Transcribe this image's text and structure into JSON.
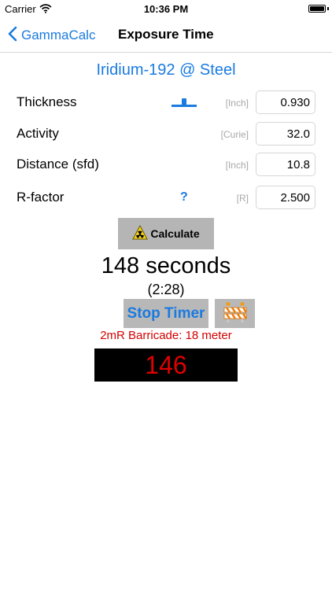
{
  "status_bar": {
    "carrier": "Carrier",
    "time": "10:36 PM"
  },
  "nav": {
    "back_label": "GammaCalc",
    "title": "Exposure Time"
  },
  "header": {
    "title": "Iridium-192 @ Steel"
  },
  "rows": [
    {
      "label": "Thickness",
      "unit": "[Inch]",
      "value": "0.930"
    },
    {
      "label": "Activity",
      "unit": "[Curie]",
      "value": "32.0"
    },
    {
      "label": "Distance (sfd)",
      "unit": "[Inch]",
      "value": "10.8"
    },
    {
      "label": "R-factor",
      "unit": "[R]",
      "value": "2.500"
    }
  ],
  "help_icon": "?",
  "calculate_label": "Calculate",
  "result": {
    "seconds_text": "148 seconds",
    "mmss_text": "(2:28)"
  },
  "stop_timer_label": "Stop Timer",
  "barricade_text": "2mR Barricade: 18 meter",
  "countdown_value": "146",
  "icons": {
    "back": "chevron-left-icon",
    "slider": "slider-icon",
    "radiation": "radiation-icon",
    "barricade": "barricade-icon"
  },
  "colors": {
    "accent": "#1a7be0",
    "alert": "#d40000",
    "countdown_bg": "#000000",
    "countdown_text": "#e00000",
    "button_bg": "#b5b5b5"
  }
}
